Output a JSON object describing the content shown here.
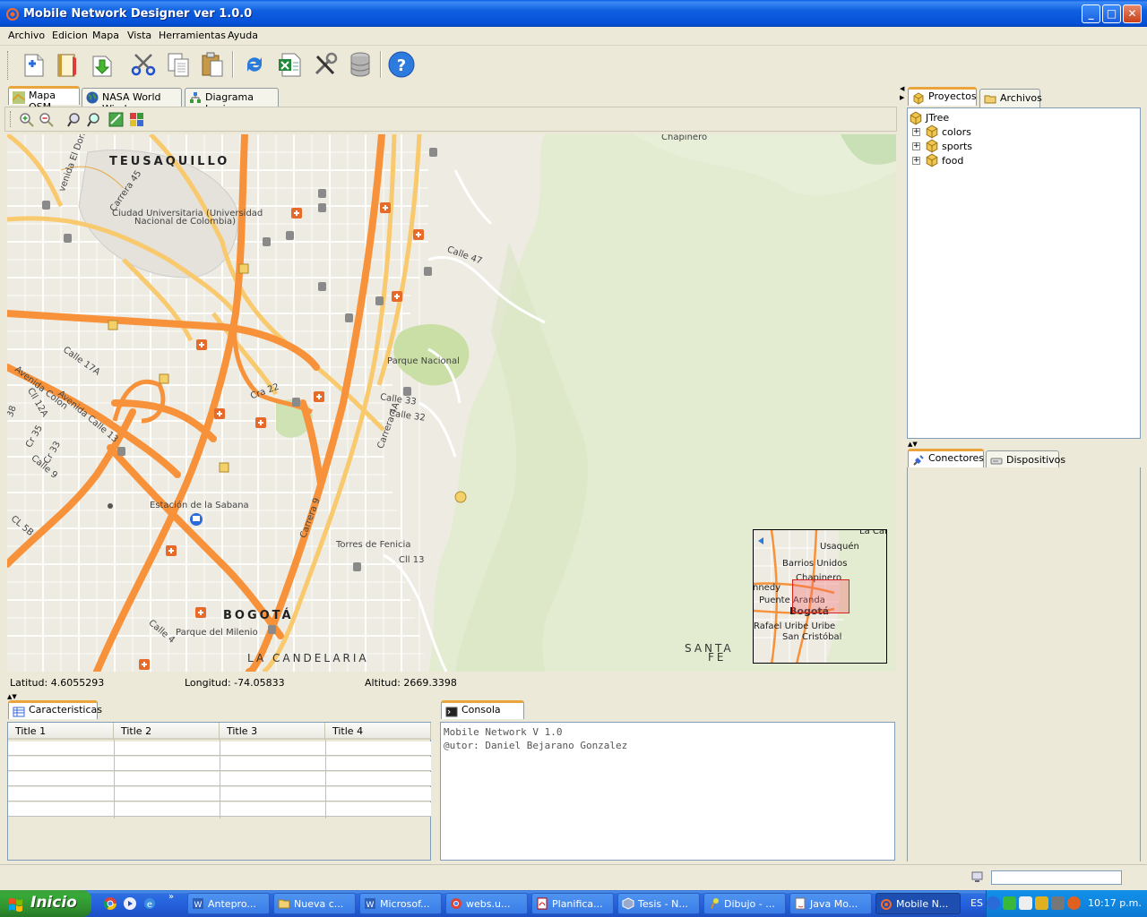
{
  "window": {
    "title": "Mobile Network Designer ver 1.0.0",
    "buttons": {
      "minimize": "_",
      "maximize": "□",
      "close": "✕"
    }
  },
  "menu": [
    "Archivo",
    "Edicion",
    "Mapa",
    "Vista",
    "Herramientas",
    "Ayuda"
  ],
  "toolbar": {
    "icons": [
      "new-icon",
      "open-icon",
      "download-icon",
      "cut-icon",
      "copy-icon",
      "paste-icon",
      "refresh-icon",
      "excel-icon",
      "tools-icon",
      "database-icon",
      "help-icon"
    ]
  },
  "map_tabs": [
    {
      "label": "Mapa OSM",
      "icon": "map-icon"
    },
    {
      "label": "NASA World Wind",
      "icon": "globe-icon"
    },
    {
      "label": "Diagrama Logico",
      "icon": "diagram-icon"
    }
  ],
  "map_tools": [
    "zoom-in-icon",
    "zoom-out-icon",
    "zoom-region-icon",
    "zoom-fit-icon",
    "layer-icon",
    "tile-icon"
  ],
  "map": {
    "labels": {
      "teusaquillo": "TEUSAQUILLO",
      "ciudad_universitaria_1": "Ciudad Universitaria (Universidad",
      "ciudad_universitaria_2": "Nacional de Colombia)",
      "chapinero": "Chapinero",
      "calle47": "Calle 47",
      "parque_nacional": "Parque Nacional",
      "calle33": "Calle 33",
      "calle32": "Calle 32",
      "carrera4a": "Carrera 4A",
      "cra22": "Cra 22",
      "calle17a": "Calle 17A",
      "avenida_colon": "Avenida Colon",
      "avenida_calle13": "Avenida Calle 13",
      "cll12a": "Cll 12A",
      "cr35": "Cr 35",
      "cr33": "Cr 33",
      "calle9": "Calle 9",
      "cl5b": "CL 5B",
      "num38": "38",
      "estacion_sabana": "Estación de la Sabana",
      "carrera9": "Carrera 9",
      "torres_fenicia": "Torres de Fenicia",
      "cll13": "Cll 13",
      "bogota": "BOGOTÁ",
      "parque_milenio": "Parque del Milenio",
      "calle4": "Calle 4",
      "la_candelaria": "LA CANDELARIA",
      "santa": "SANTA",
      "fe": "FE",
      "avenida_eldorado": "venida El Dorado",
      "carrera45": "Carrera 45"
    },
    "minimap": {
      "usaquen": "Usaquén",
      "la_cal": "La Cal",
      "barrios_unidos": "Barrios Unidos",
      "chapinero": "Chapinero",
      "kennedy": "nnedy",
      "puente_aranda": "Puente Aranda",
      "bogota": "Bogotá",
      "rafael_uribe": "Rafael Uribe Uribe",
      "san_cristobal": "San Cristóbal"
    },
    "colors": {
      "land": "#eeebe3",
      "park": "#e2ecd0",
      "major_road": "#f7923a",
      "secondary_road": "#f9c96e",
      "block": "#dcd8d0"
    }
  },
  "coords": {
    "lat": "Latitud: 4.6055293",
    "lon": "Longitud: -74.05833",
    "alt": "Altitud: 2669.3398"
  },
  "bottom_left": {
    "tab": "Caracteristicas",
    "columns": [
      "Title 1",
      "Title 2",
      "Title 3",
      "Title 4"
    ],
    "rows": [
      [
        "",
        "",
        "",
        ""
      ],
      [
        "",
        "",
        "",
        ""
      ],
      [
        "",
        "",
        "",
        ""
      ],
      [
        "",
        "",
        "",
        ""
      ],
      [
        "",
        "",
        "",
        ""
      ]
    ]
  },
  "console": {
    "tab": "Consola",
    "lines": [
      "Mobile Network V 1.0",
      "@utor: Daniel Bejarano Gonzalez"
    ]
  },
  "right_top": {
    "tabs": [
      "Proyectos",
      "Archivos"
    ],
    "tree_root": "JTree",
    "tree_items": [
      "colors",
      "sports",
      "food"
    ]
  },
  "right_bottom": {
    "tabs": [
      "Conectores",
      "Dispositivos"
    ]
  },
  "taskbar": {
    "start": "Inicio",
    "tasks": [
      "Antepro...",
      "Nueva c...",
      "Microsof...",
      "webs.u...",
      "Planifica...",
      "Tesis - N...",
      "Dibujo - ...",
      "Java Mo...",
      "Mobile N..."
    ],
    "language": "ES",
    "clock": "10:17 p.m."
  }
}
